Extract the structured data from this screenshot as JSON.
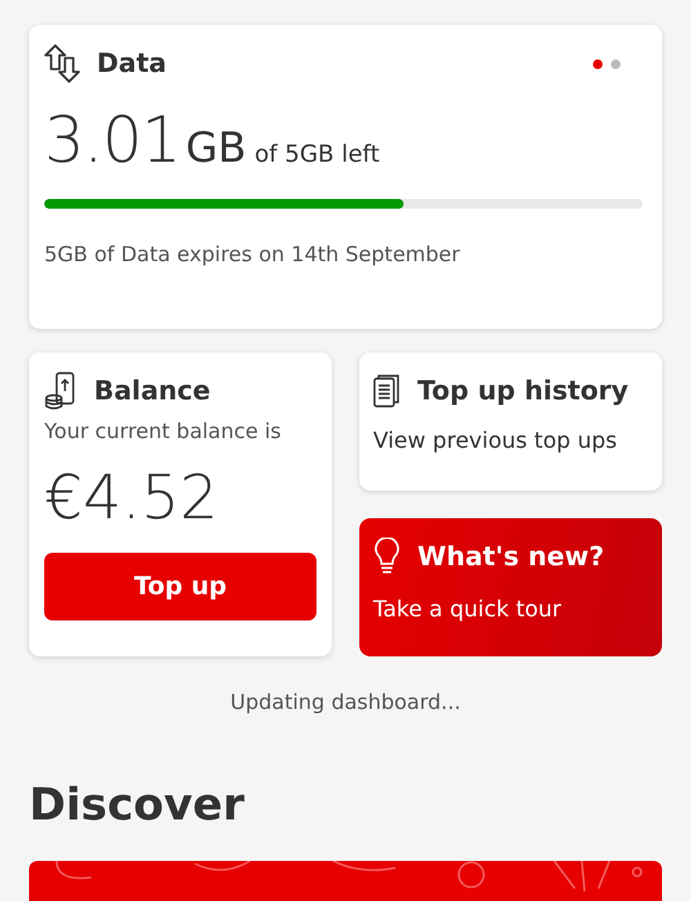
{
  "data_card": {
    "title": "Data",
    "pager": [
      {
        "selected": true
      },
      {
        "selected": false
      }
    ],
    "amount": "3.01",
    "unit": "GB",
    "allowance": "of 5GB left",
    "level": 0.6,
    "expiry": "5GB of Data expires on 14th September"
  },
  "balance_card": {
    "title": "Balance",
    "caption": "Your current balance is",
    "amount": "€4.52",
    "button": "Top up"
  },
  "history_card": {
    "title": "Top up history",
    "subtitle": "View previous top ups"
  },
  "whats_new_card": {
    "title": "What's new?",
    "subtitle": "Take a quick tour"
  },
  "status": "Updating dashboard...",
  "discover": {
    "heading": "Discover"
  }
}
